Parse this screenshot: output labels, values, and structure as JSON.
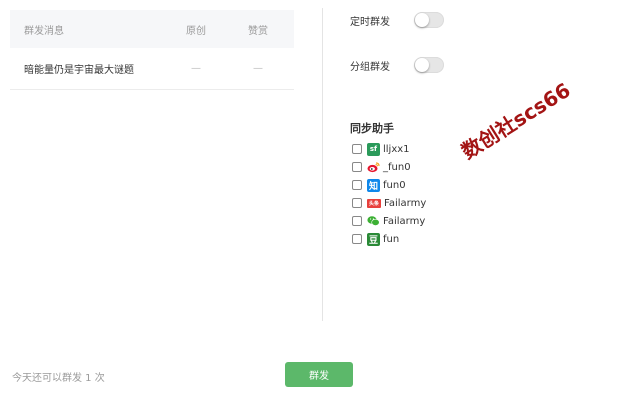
{
  "table": {
    "headers": {
      "title": "群发消息",
      "original": "原创",
      "likes": "赞赏"
    },
    "rows": [
      {
        "title": "暗能量仍是宇宙最大谜题",
        "original": "—",
        "likes": "—"
      }
    ]
  },
  "settings": {
    "scheduled": {
      "label": "定时群发",
      "enabled": false
    },
    "group": {
      "label": "分组群发",
      "enabled": false
    }
  },
  "sync": {
    "title": "同步助手",
    "platforms": [
      {
        "icon": "segmentfault-icon",
        "glyph": "sf",
        "account": "lljxx1",
        "checked": false
      },
      {
        "icon": "weibo-icon",
        "glyph": "",
        "account": "_fun0",
        "checked": false
      },
      {
        "icon": "zhihu-icon",
        "glyph": "知",
        "account": "fun0",
        "checked": false
      },
      {
        "icon": "toutiao-icon",
        "glyph": "头条",
        "account": "Failarmy",
        "checked": false
      },
      {
        "icon": "wechat-icon",
        "glyph": "",
        "account": "Failarmy",
        "checked": false
      },
      {
        "icon": "douban-icon",
        "glyph": "豆",
        "account": "fun",
        "checked": false
      }
    ]
  },
  "watermark": "数创社scs66",
  "footer": {
    "quota": "今天还可以群发 1 次",
    "send_label": "群发"
  },
  "colors": {
    "accent": "#5cb86a",
    "watermark": "#a31414",
    "header_bg": "#f6f7f9"
  }
}
